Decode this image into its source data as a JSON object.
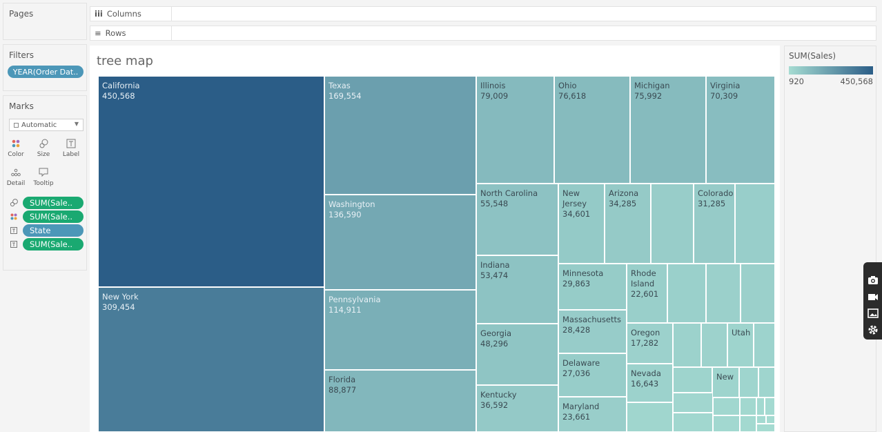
{
  "left_panel": {
    "pages_title": "Pages",
    "filters_title": "Filters",
    "filter_pill": "YEAR(Order Dat..",
    "marks_title": "Marks",
    "mark_type": "Automatic",
    "mark_buttons": {
      "color": "Color",
      "size": "Size",
      "label": "Label",
      "detail": "Detail",
      "tooltip": "Tooltip"
    },
    "mark_fields": [
      {
        "icon": "size-icon",
        "label": "SUM(Sale..",
        "color": "#1aa971"
      },
      {
        "icon": "color-icon",
        "label": "SUM(Sale..",
        "color": "#1aa971"
      },
      {
        "icon": "label-icon",
        "label": "State",
        "color": "#4c97b8"
      },
      {
        "icon": "label-icon",
        "label": "SUM(Sale..",
        "color": "#1aa971"
      }
    ]
  },
  "shelves": {
    "columns_label": "Columns",
    "rows_label": "Rows"
  },
  "viz": {
    "title": "tree map"
  },
  "legend": {
    "title": "SUM(Sales)",
    "min_label": "920",
    "max_label": "450,568",
    "min_color": "#a6dcd2",
    "max_color": "#2b5d87"
  },
  "chart_data": {
    "type": "treemap",
    "title": "tree map",
    "color_measure": "SUM(Sales)",
    "size_measure": "SUM(Sales)",
    "items": [
      {
        "name": "California",
        "value": "450,568"
      },
      {
        "name": "New York",
        "value": "309,454"
      },
      {
        "name": "Texas",
        "value": "169,554"
      },
      {
        "name": "Washington",
        "value": "136,590"
      },
      {
        "name": "Pennsylvania",
        "value": "114,911"
      },
      {
        "name": "Florida",
        "value": "88,877"
      },
      {
        "name": "Illinois",
        "value": "79,009"
      },
      {
        "name": "Ohio",
        "value": "76,618"
      },
      {
        "name": "Michigan",
        "value": "75,992"
      },
      {
        "name": "Virginia",
        "value": "70,309"
      },
      {
        "name": "North Carolina",
        "value": "55,548"
      },
      {
        "name": "New\nJersey",
        "value": "34,601"
      },
      {
        "name": "Arizona",
        "value": "34,285"
      },
      {
        "name": "Colorado",
        "value": "31,285"
      },
      {
        "name": "Indiana",
        "value": "53,474"
      },
      {
        "name": "Minnesota",
        "value": "29,863"
      },
      {
        "name": "Rhode\nIsland",
        "value": "22,601"
      },
      {
        "name": "Georgia",
        "value": "48,296"
      },
      {
        "name": "Massachusetts",
        "value": "28,428"
      },
      {
        "name": "Oregon",
        "value": "17,282"
      },
      {
        "name": "Utah",
        "value": ""
      },
      {
        "name": "Delaware",
        "value": "27,036"
      },
      {
        "name": "Nevada",
        "value": "16,643"
      },
      {
        "name": "New",
        "value": ""
      },
      {
        "name": "Kentucky",
        "value": "36,592"
      },
      {
        "name": "Maryland",
        "value": "23,661"
      }
    ]
  }
}
